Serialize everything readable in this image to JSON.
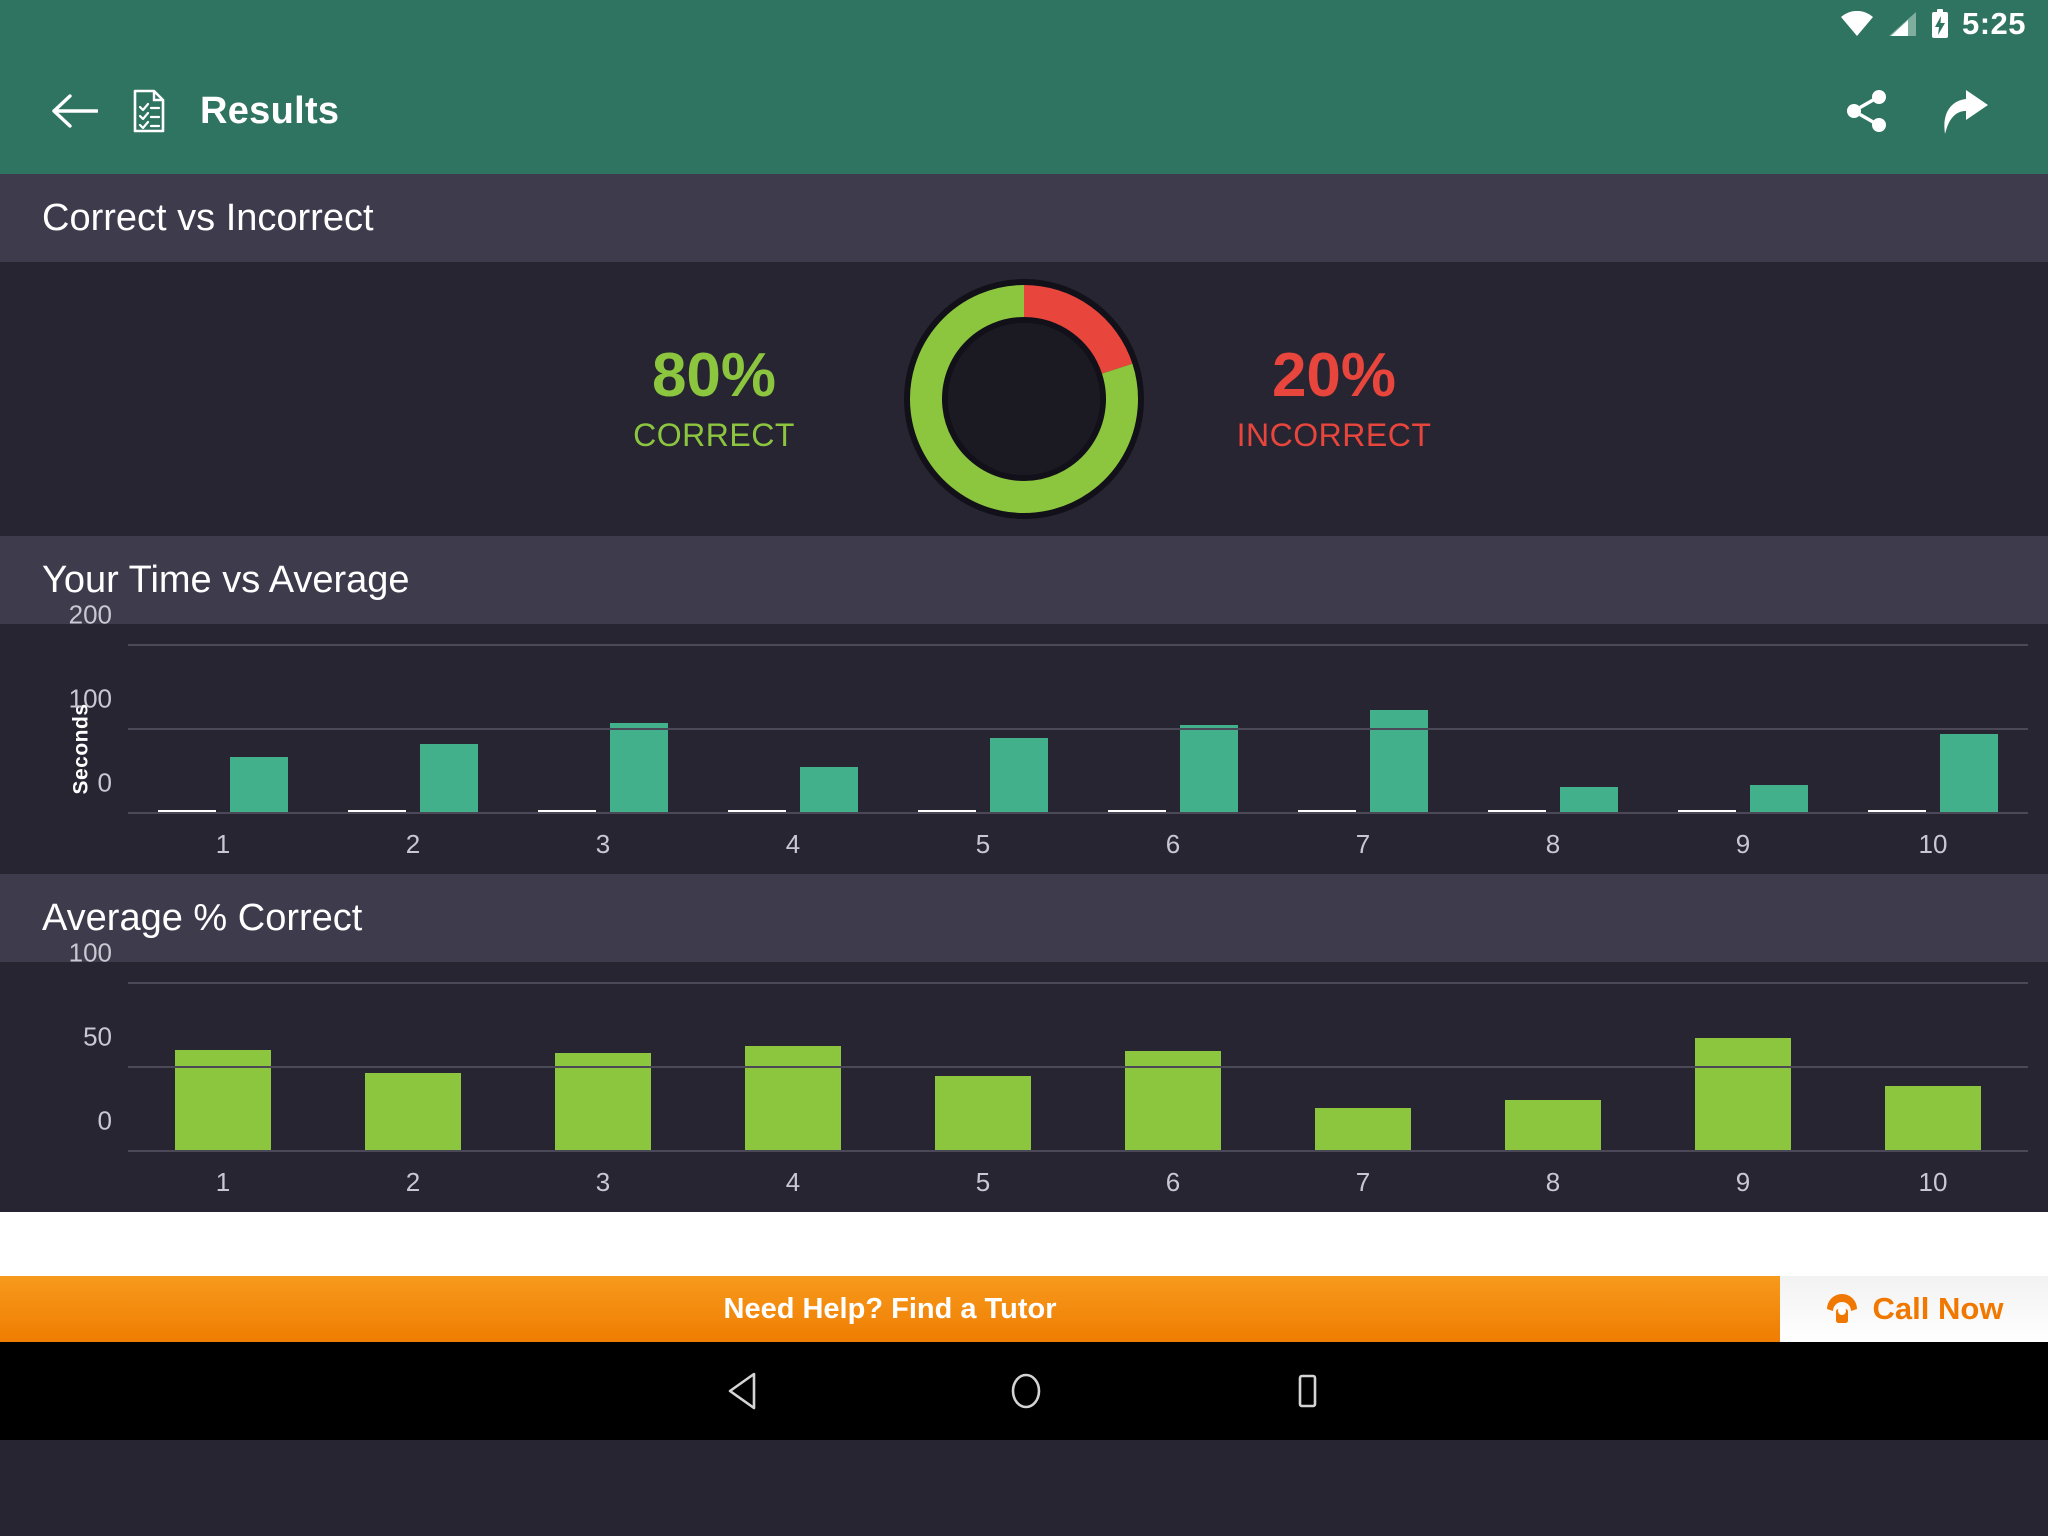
{
  "status_bar": {
    "time": "5:25",
    "icons": [
      "wifi-icon",
      "cellular-signal-icon",
      "battery-charging-icon"
    ]
  },
  "app_bar": {
    "back_label": "back-arrow-icon",
    "doc_icon": "results-document-icon",
    "title": "Results",
    "share_label": "share-icon",
    "forward_label": "forward-arrow-icon"
  },
  "sections": {
    "correct_vs_incorrect": {
      "title": "Correct vs Incorrect"
    },
    "time_vs_average": {
      "title": "Your Time vs Average"
    },
    "average_pct_correct": {
      "title": "Average % Correct"
    }
  },
  "donut": {
    "correct_value": "80%",
    "correct_label": "CORRECT",
    "incorrect_value": "20%",
    "incorrect_label": "INCORRECT",
    "correct_pct": 80,
    "incorrect_pct": 20,
    "correct_color": "#8cc63e",
    "incorrect_color": "#e8453c",
    "hole_color": "#1b1a22"
  },
  "ad": {
    "text": "Need Help? Find a Tutor",
    "cta_text": "Call Now",
    "cta_icon": "telephone-icon",
    "banner_color": "#ef7d02"
  },
  "nav_bar": {
    "back": "nav-back-triangle-icon",
    "home": "nav-home-circle-icon",
    "recents": "nav-recents-square-icon"
  },
  "chart_data": [
    {
      "type": "bar",
      "title": "Your Time vs Average",
      "xlabel": "",
      "ylabel": "Seconds",
      "categories": [
        "1",
        "2",
        "3",
        "4",
        "5",
        "6",
        "7",
        "8",
        "9",
        "10"
      ],
      "ylim": [
        0,
        200
      ],
      "yticks": [
        0,
        100,
        200
      ],
      "grid": true,
      "legend": "none",
      "series": [
        {
          "name": "Your Time",
          "color": "#ffffff",
          "values": [
            5,
            5,
            5,
            5,
            5,
            5,
            5,
            5,
            5,
            5
          ]
        },
        {
          "name": "Average",
          "color": "#43b08c",
          "values": [
            68,
            83,
            108,
            56,
            90,
            106,
            124,
            32,
            35,
            95
          ]
        }
      ]
    },
    {
      "type": "bar",
      "title": "Average % Correct",
      "xlabel": "",
      "ylabel": "",
      "categories": [
        "1",
        "2",
        "3",
        "4",
        "5",
        "6",
        "7",
        "8",
        "9",
        "10"
      ],
      "ylim": [
        0,
        100
      ],
      "yticks": [
        0,
        50,
        100
      ],
      "grid": true,
      "legend": "none",
      "series": [
        {
          "name": "Average % Correct",
          "color": "#8cc63e",
          "values": [
            61,
            47,
            59,
            63,
            45,
            60,
            26,
            31,
            68,
            39
          ]
        }
      ]
    }
  ]
}
